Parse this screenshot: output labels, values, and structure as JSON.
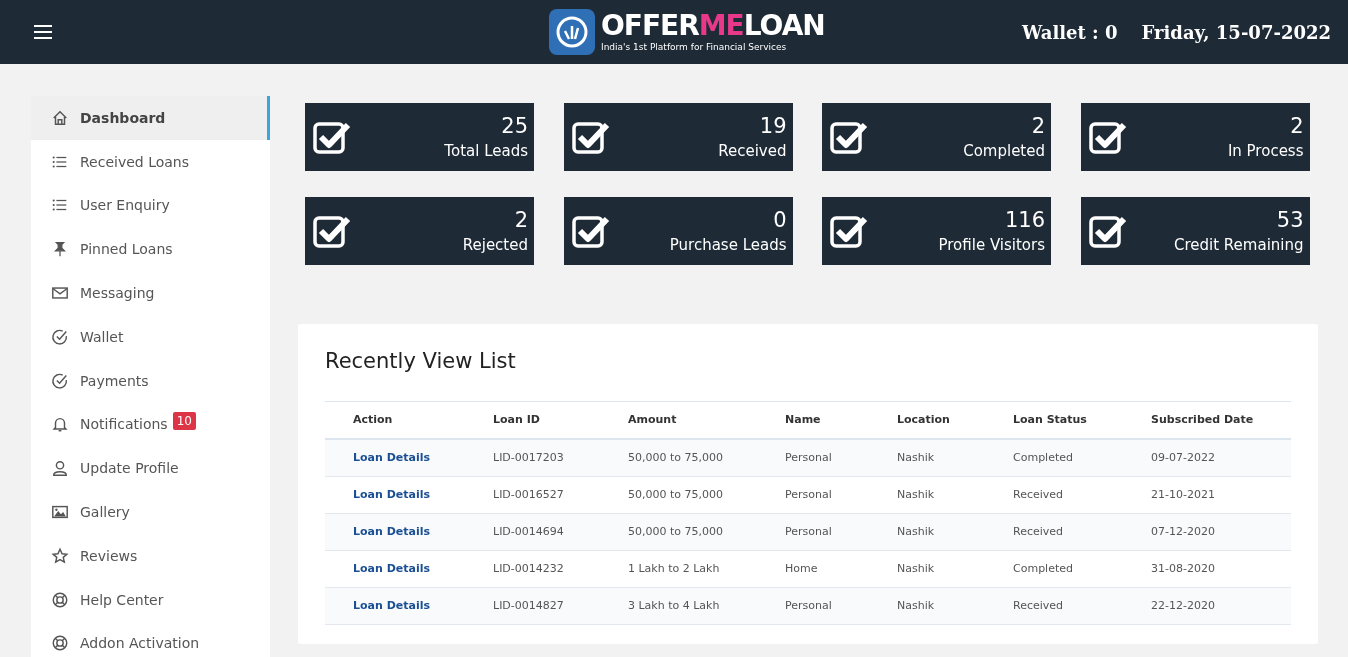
{
  "header": {
    "logo": {
      "prefix": "OFFER",
      "highlight": "ME",
      "suffix": "LOAN",
      "tagline": "India's 1st Platform for Financial Services"
    },
    "wallet": "Wallet : 0",
    "date": "Friday, 15-07-2022"
  },
  "sidebar": {
    "items": [
      {
        "label": "Dashboard",
        "kind": "home",
        "selected": true
      },
      {
        "label": "Received Loans",
        "kind": "list",
        "selected": false
      },
      {
        "label": "User Enquiry",
        "kind": "list",
        "selected": false
      },
      {
        "label": "Pinned Loans",
        "kind": "pin",
        "selected": false
      },
      {
        "label": "Messaging",
        "kind": "mail",
        "selected": false
      },
      {
        "label": "Wallet",
        "kind": "check",
        "selected": false
      },
      {
        "label": "Payments",
        "kind": "check",
        "selected": false
      },
      {
        "label": "Notifications",
        "kind": "bell",
        "selected": false,
        "badge": "10"
      },
      {
        "label": "Update Profile",
        "kind": "user",
        "selected": false
      },
      {
        "label": "Gallery",
        "kind": "image",
        "selected": false
      },
      {
        "label": "Reviews",
        "kind": "star",
        "selected": false
      },
      {
        "label": "Help Center",
        "kind": "lifebuoy",
        "selected": false
      },
      {
        "label": "Addon Activation",
        "kind": "lifebuoy",
        "selected": false
      }
    ]
  },
  "stats": [
    {
      "value": "25",
      "label": "Total Leads"
    },
    {
      "value": "19",
      "label": "Received"
    },
    {
      "value": "2",
      "label": "Completed"
    },
    {
      "value": "2",
      "label": "In Process"
    },
    {
      "value": "2",
      "label": "Rejected"
    },
    {
      "value": "0",
      "label": "Purchase Leads"
    },
    {
      "value": "116",
      "label": "Profile Visitors"
    },
    {
      "value": "53",
      "label": "Credit Remaining"
    }
  ],
  "recent": {
    "title": "Recently View List",
    "columns": [
      "Action",
      "Loan ID",
      "Amount",
      "Name",
      "Location",
      "Loan Status",
      "Subscribed Date"
    ],
    "rows": [
      [
        "Loan Details",
        "LID-0017203",
        "50,000 to 75,000",
        "Personal",
        "Nashik",
        "Completed",
        "09-07-2022"
      ],
      [
        "Loan Details",
        "LID-0016527",
        "50,000 to 75,000",
        "Personal",
        "Nashik",
        "Received",
        "21-10-2021"
      ],
      [
        "Loan Details",
        "LID-0014694",
        "50,000 to 75,000",
        "Personal",
        "Nashik",
        "Received",
        "07-12-2020"
      ],
      [
        "Loan Details",
        "LID-0014232",
        "1 Lakh to 2 Lakh",
        "Home",
        "Nashik",
        "Completed",
        "31-08-2020"
      ],
      [
        "Loan Details",
        "LID-0014827",
        "3 Lakh to 4 Lakh",
        "Personal",
        "Nashik",
        "Received",
        "22-12-2020"
      ]
    ]
  }
}
